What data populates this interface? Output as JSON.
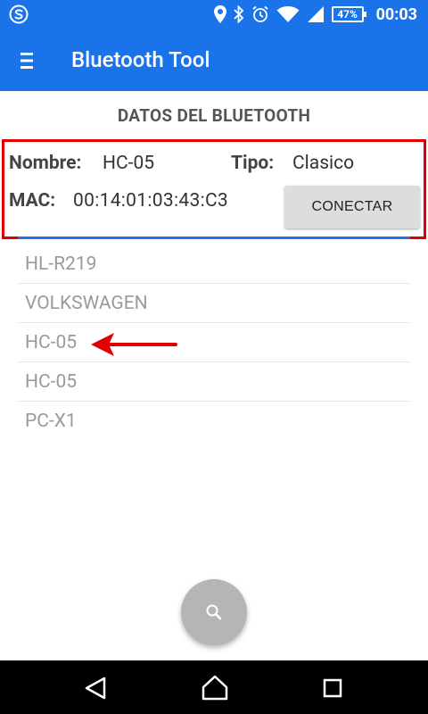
{
  "status_bar": {
    "battery": "47%",
    "time": "00:03"
  },
  "app_bar": {
    "title": "Bluetooth Tool"
  },
  "section_title": "DATOS DEL BLUETOOTH",
  "device_info": {
    "name_label": "Nombre:",
    "name_value": "HC-05",
    "type_label": "Tipo:",
    "type_value": "Clasico",
    "mac_label": "MAC:",
    "mac_value": "00:14:01:03:43:C3",
    "connect_button": "CONECTAR"
  },
  "devices": [
    "HL-R219",
    "VOLKSWAGEN",
    "HC-05",
    "HC-05",
    "PC-X1"
  ],
  "colors": {
    "primary": "#1a73e8",
    "highlight": "#e00000",
    "fab": "#b5b5b5"
  },
  "icons": {
    "app": "app-s-logo-icon",
    "location": "location-pin-icon",
    "bluetooth": "bluetooth-icon",
    "alarm": "alarm-clock-icon",
    "wifi": "wifi-icon",
    "signal": "cell-signal-icon",
    "menu": "hamburger-menu-icon",
    "search": "search-icon",
    "back": "nav-back-icon",
    "home": "nav-home-icon",
    "recents": "nav-recents-icon"
  }
}
